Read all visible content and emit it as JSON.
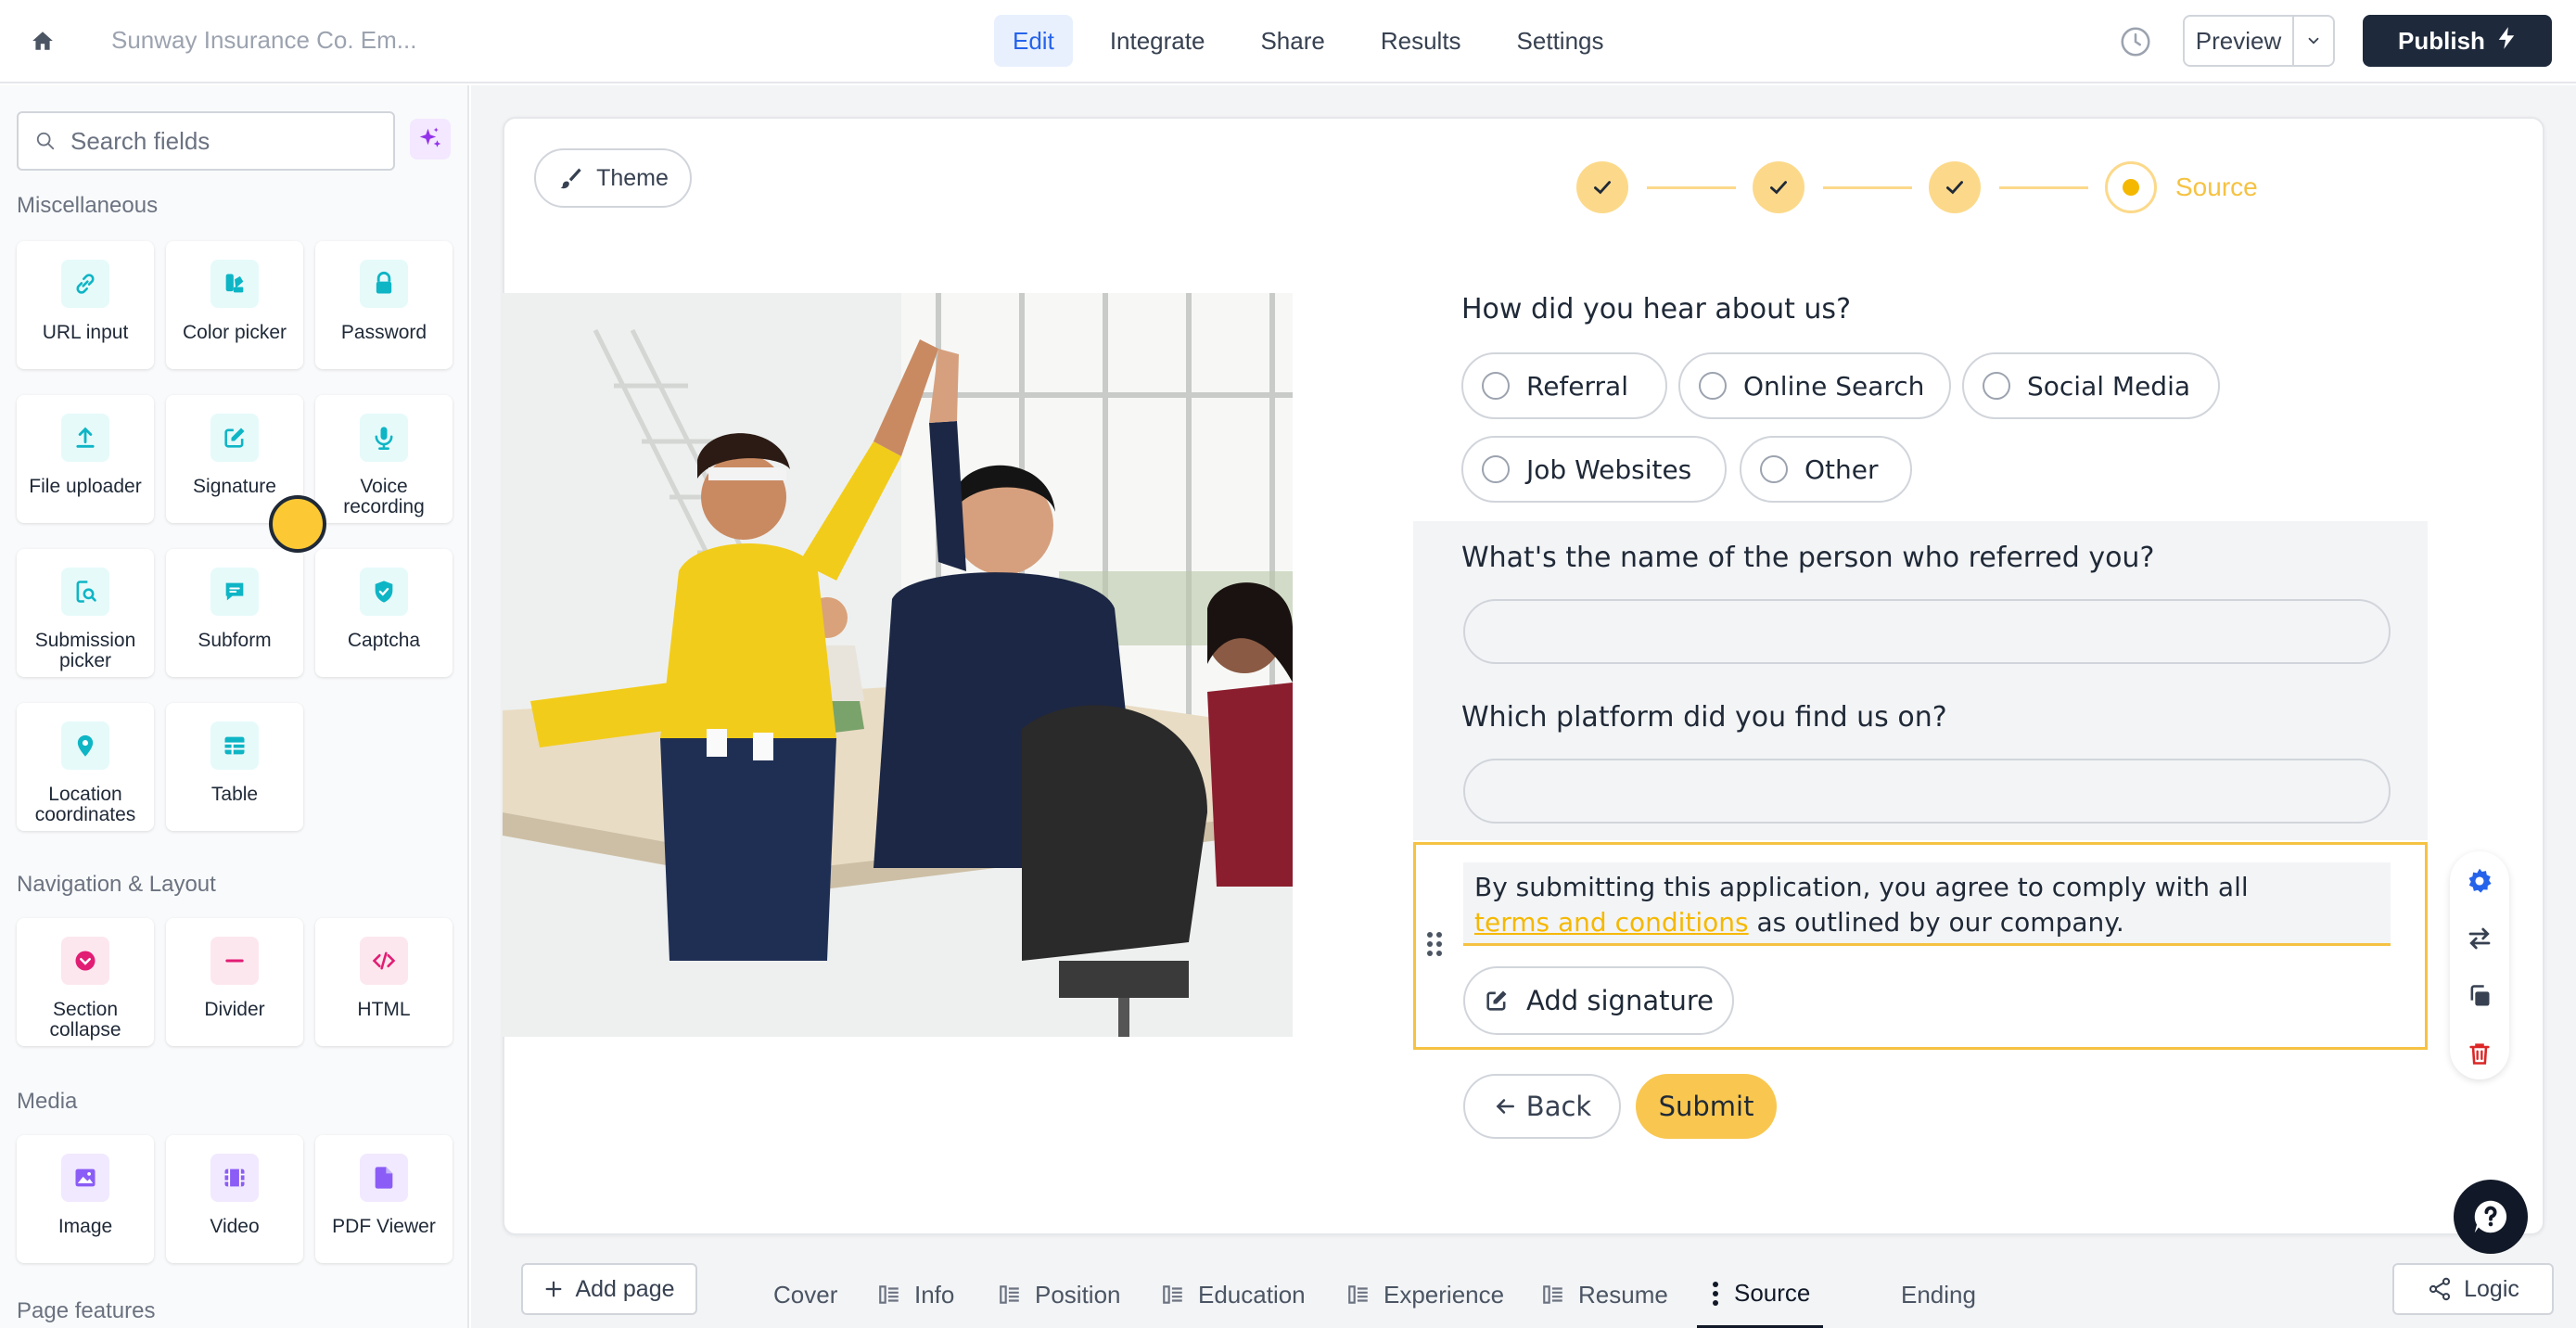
{
  "header": {
    "form_title": "Sunway Insurance Co. Em...",
    "tabs": [
      "Edit",
      "Integrate",
      "Share",
      "Results",
      "Settings"
    ],
    "active_tab": "Edit",
    "preview_label": "Preview",
    "publish_label": "Publish"
  },
  "sidebar": {
    "search_placeholder": "Search fields",
    "sections": {
      "misc": "Miscellaneous",
      "nav": "Navigation & Layout",
      "media": "Media",
      "page_features": "Page features"
    },
    "misc_fields": [
      {
        "label": "URL input",
        "icon": "link-icon"
      },
      {
        "label": "Color picker",
        "icon": "color-picker-icon"
      },
      {
        "label": "Password",
        "icon": "lock-icon"
      },
      {
        "label": "File uploader",
        "icon": "upload-icon"
      },
      {
        "label": "Signature",
        "icon": "signature-icon"
      },
      {
        "label": "Voice recording",
        "icon": "microphone-icon"
      },
      {
        "label": "Submission picker",
        "icon": "submission-picker-icon"
      },
      {
        "label": "Subform",
        "icon": "subform-icon"
      },
      {
        "label": "Captcha",
        "icon": "shield-check-icon"
      },
      {
        "label": "Location coordinates",
        "icon": "location-pin-icon"
      },
      {
        "label": "Table",
        "icon": "table-icon"
      }
    ],
    "nav_fields": [
      {
        "label": "Section collapse",
        "icon": "collapse-icon"
      },
      {
        "label": "Divider",
        "icon": "divider-icon"
      },
      {
        "label": "HTML",
        "icon": "code-icon"
      }
    ],
    "media_fields": [
      {
        "label": "Image",
        "icon": "image-icon"
      },
      {
        "label": "Video",
        "icon": "video-icon"
      },
      {
        "label": "PDF Viewer",
        "icon": "pdf-icon"
      }
    ]
  },
  "canvas": {
    "theme_label": "Theme",
    "step_label": "Source",
    "q1": {
      "title": "How did you hear about us?",
      "options": [
        "Referral",
        "Online Search",
        "Social Media",
        "Job Websites",
        "Other"
      ]
    },
    "q2_title": "What's the name of the person who referred you?",
    "q3_title": "Which platform did you find us on?",
    "agreement": {
      "line1": "By submitting this application, you agree to comply with all",
      "link": "terms and conditions",
      "line2_rest": " as outlined by our company."
    },
    "add_signature_label": "Add signature",
    "back_label": "Back",
    "submit_label": "Submit"
  },
  "footer": {
    "add_page_label": "Add page",
    "pages": [
      "Cover",
      "Info",
      "Position",
      "Education",
      "Experience",
      "Resume",
      "Source",
      "Ending"
    ],
    "active_page": "Source",
    "logic_label": "Logic"
  },
  "colors": {
    "accent": "#f5c242",
    "edit_tab": "#2563eb",
    "publish_bg": "#1e293b"
  }
}
